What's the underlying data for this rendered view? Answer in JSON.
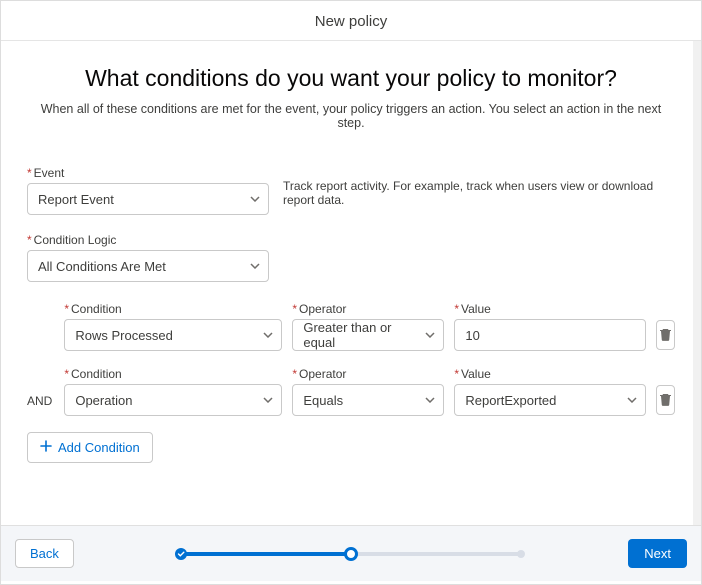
{
  "header": {
    "title": "New policy"
  },
  "page": {
    "heading": "What conditions do you want your policy to monitor?",
    "subtitle": "When all of these conditions are met for the event, your policy triggers an action. You select an action in the next step."
  },
  "event": {
    "label": "Event",
    "value": "Report Event",
    "hint": "Track report activity. For example, track when users view or download report data."
  },
  "logic": {
    "label": "Condition Logic",
    "value": "All Conditions Are Met"
  },
  "labels": {
    "condition": "Condition",
    "operator": "Operator",
    "value": "Value",
    "and": "AND"
  },
  "conditions": [
    {
      "condition": "Rows Processed",
      "operator": "Greater than or equal",
      "value": "10",
      "value_type": "input"
    },
    {
      "condition": "Operation",
      "operator": "Equals",
      "value": "ReportExported",
      "value_type": "select"
    }
  ],
  "buttons": {
    "add": "Add Condition",
    "back": "Back",
    "next": "Next"
  },
  "colors": {
    "accent": "#0070d2",
    "required": "#c23934"
  }
}
